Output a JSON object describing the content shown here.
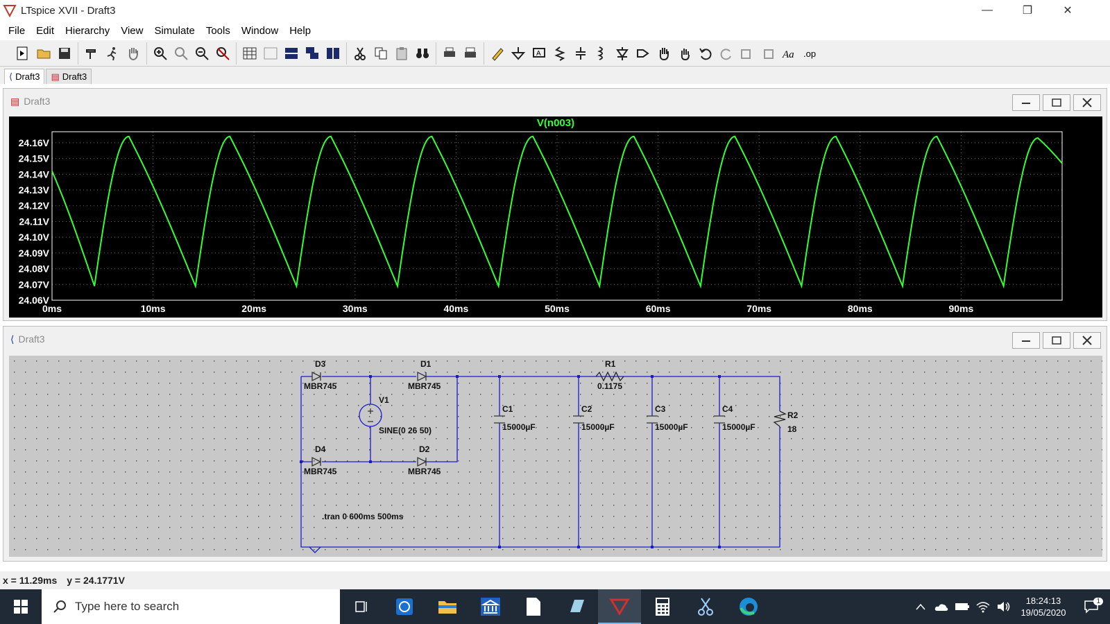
{
  "window": {
    "title": "LTspice XVII - Draft3",
    "controls": {
      "minimize": "—",
      "restore": "❐",
      "close": "✕"
    }
  },
  "menu": [
    {
      "label": "File"
    },
    {
      "label": "Edit"
    },
    {
      "label": "Hierarchy"
    },
    {
      "label": "View"
    },
    {
      "label": "Simulate"
    },
    {
      "label": "Tools"
    },
    {
      "label": "Window"
    },
    {
      "label": "Help"
    }
  ],
  "tabs": [
    {
      "label": "Draft3",
      "icon": "schematic-icon",
      "active": true
    },
    {
      "label": "Draft3",
      "icon": "waveform-icon",
      "active": false
    }
  ],
  "waveform_window": {
    "title": "Draft3",
    "trace_label": "V(n003)",
    "trace_color": "#33ff33"
  },
  "schematic_window": {
    "title": "Draft3",
    "components": {
      "D3": {
        "name": "D3",
        "model": "MBR745"
      },
      "D1": {
        "name": "D1",
        "model": "MBR745"
      },
      "D4": {
        "name": "D4",
        "model": "MBR745"
      },
      "D2": {
        "name": "D2",
        "model": "MBR745"
      },
      "V1": {
        "name": "V1",
        "value": "SINE(0 26 50)"
      },
      "R1": {
        "name": "R1",
        "value": "0.1175"
      },
      "R2": {
        "name": "R2",
        "value": "18"
      },
      "C1": {
        "name": "C1",
        "value": "15000µF"
      },
      "C2": {
        "name": "C2",
        "value": "15000µF"
      },
      "C3": {
        "name": "C3",
        "value": "15000µF"
      },
      "C4": {
        "name": "C4",
        "value": "15000µF"
      }
    },
    "directive": ".tran 0 600ms 500ms",
    "wire_color": "#1a1acc"
  },
  "status": {
    "x": "x = 11.29ms",
    "y": "y = 24.1771V"
  },
  "taskbar": {
    "search_placeholder": "Type here to search",
    "time": "18:24:13",
    "date": "19/05/2020",
    "notification_count": "1"
  },
  "chart_data": {
    "type": "line",
    "title": "V(n003)",
    "xlabel": "",
    "ylabel": "",
    "x_ticks": [
      "0ms",
      "10ms",
      "20ms",
      "30ms",
      "40ms",
      "50ms",
      "60ms",
      "70ms",
      "80ms",
      "90ms"
    ],
    "y_ticks": [
      "24.16V",
      "24.15V",
      "24.14V",
      "24.13V",
      "24.12V",
      "24.11V",
      "24.10V",
      "24.09V",
      "24.08V",
      "24.07V",
      "24.06V"
    ],
    "xlim": [
      0,
      100
    ],
    "ylim": [
      24.06,
      24.167
    ],
    "grid": true,
    "series": [
      {
        "color": "#33ff33",
        "x": [
          0,
          4.2,
          7.6,
          14.2,
          17.6,
          24.2,
          27.6,
          34.2,
          37.6,
          44.2,
          47.6,
          54.2,
          57.6,
          64.2,
          67.6,
          74.2,
          77.6,
          84.2,
          87.6,
          94.2,
          97.6,
          100
        ],
        "y": [
          24.142,
          24.069,
          24.164,
          24.069,
          24.164,
          24.069,
          24.164,
          24.069,
          24.164,
          24.069,
          24.164,
          24.069,
          24.164,
          24.069,
          24.164,
          24.069,
          24.164,
          24.069,
          24.164,
          24.069,
          24.163,
          24.147
        ]
      }
    ]
  }
}
